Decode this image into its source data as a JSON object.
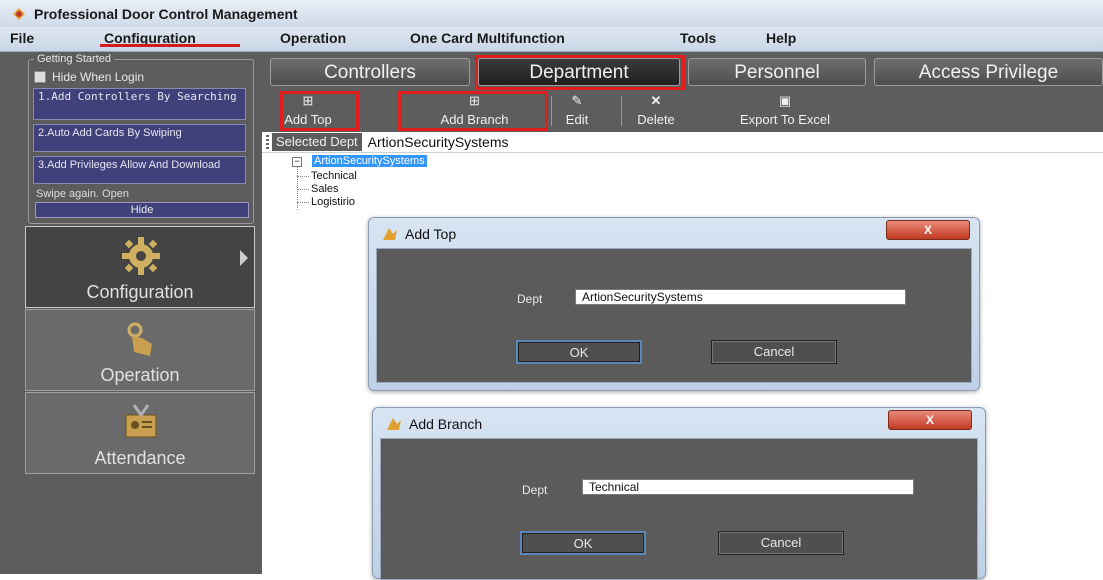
{
  "window": {
    "title": "Professional Door Control Management"
  },
  "menu": {
    "items": [
      "File",
      "Configuration",
      "Operation",
      "One Card Multifunction",
      "Tools",
      "Help"
    ]
  },
  "sidebar": {
    "getting_started": {
      "legend": "Getting Started",
      "hide_when_login": "Hide When Login",
      "steps": [
        "1.Add Controllers By Searching",
        "2.Auto Add Cards By Swiping",
        "3.Add Privileges Allow And Download"
      ],
      "swipe_text": "Swipe again. Open",
      "hide_button": "Hide"
    },
    "nav": [
      {
        "label": "Configuration",
        "icon": "gear-icon",
        "active": true
      },
      {
        "label": "Operation",
        "icon": "hand-pointer-icon",
        "active": false
      },
      {
        "label": "Attendance",
        "icon": "attendance-icon",
        "active": false
      }
    ]
  },
  "tabs": [
    "Controllers",
    "Department",
    "Personnel",
    "Access Privilege"
  ],
  "selected_tab": "Department",
  "toolbar": {
    "buttons": [
      {
        "label": "Add Top",
        "icon": "add-top-icon"
      },
      {
        "label": "Add Branch",
        "icon": "add-branch-icon"
      },
      {
        "label": "Edit",
        "icon": "pencil-icon"
      },
      {
        "label": "Delete",
        "icon": "delete-x-icon"
      },
      {
        "label": "Export To Excel",
        "icon": "excel-icon"
      }
    ]
  },
  "selected_dept": {
    "label": "Selected Dept",
    "value": "ArtionSecuritySystems"
  },
  "tree": {
    "root": "ArtionSecuritySystems",
    "children": [
      "Technical",
      "Sales",
      "Logistirio"
    ]
  },
  "dialogs": {
    "add_top": {
      "title": "Add Top",
      "field_label": "Dept",
      "field_value": "ArtionSecuritySystems",
      "ok": "OK",
      "cancel": "Cancel",
      "close": "X"
    },
    "add_branch": {
      "title": "Add Branch",
      "field_label": "Dept",
      "field_value": "Technical",
      "ok": "OK",
      "cancel": "Cancel",
      "close": "X"
    }
  },
  "colors": {
    "highlight_box": "#e11d1d",
    "panel_dark": "#5d5d5d",
    "tree_selection": "#3396ff",
    "step_button": "#40407a"
  }
}
